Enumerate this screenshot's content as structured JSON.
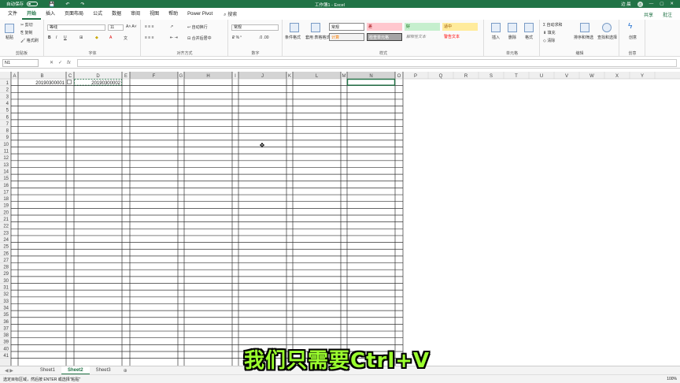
{
  "titlebar": {
    "autosave": "自动保存",
    "autosave_state": "关",
    "title": "工作簿1 - Excel",
    "user": "边 晨",
    "avatar": "边",
    "win_min": "—",
    "win_max": "▢",
    "win_close": "✕"
  },
  "tabs": [
    "文件",
    "开始",
    "插入",
    "页面布局",
    "公式",
    "数据",
    "审阅",
    "视图",
    "帮助",
    "Power Pivot"
  ],
  "search": "搜索",
  "share": "共享",
  "comment": "批注",
  "ribbon": {
    "clipboard": {
      "label": "剪贴板",
      "paste": "粘贴",
      "cut": "剪切",
      "copy": "复制",
      "painter": "格式刷"
    },
    "font": {
      "label": "字体",
      "name": "等线",
      "size": "11"
    },
    "align": {
      "label": "对齐方式",
      "wrap": "自动换行",
      "merge": "合并后居中"
    },
    "number": {
      "label": "数字",
      "format": "常规"
    },
    "styles": {
      "label": "样式",
      "cond": "条件格式",
      "table": "套用\n表格格式",
      "normal": "常规",
      "bad": "差",
      "good": "好",
      "neutral": "适中",
      "calc": "计算",
      "check": "检查单元格",
      "explain": "解释性文本",
      "warn": "警告文本"
    },
    "cells": {
      "label": "单元格",
      "insert": "插入",
      "delete": "删除",
      "format": "格式"
    },
    "edit": {
      "label": "编辑",
      "autosum": "自动求和",
      "fill": "填充",
      "clear": "清除",
      "sort": "排序和筛选",
      "find": "查找和选择"
    },
    "create": {
      "label": "创意",
      "idea": "创意"
    }
  },
  "formula": {
    "namebox": "N1",
    "fx": "fx",
    "value": ""
  },
  "columns": [
    "A",
    "B",
    "C",
    "D",
    "E",
    "F",
    "G",
    "H",
    "I",
    "J",
    "K",
    "L",
    "M",
    "N",
    "O",
    "P",
    "Q",
    "R",
    "S",
    "T",
    "U",
    "V",
    "W",
    "X",
    "Y"
  ],
  "cells": {
    "B1": "20190300001",
    "D1": "20190300002"
  },
  "sheets": [
    "Sheet1",
    "Sheet2",
    "Sheet3"
  ],
  "status": {
    "left": "选定目标区域，然后按 ENTER 或选择\"粘贴\"",
    "zoom": "100%"
  },
  "subtitle": "我们只需要Ctrl+V",
  "colors": {
    "excel_green": "#217346",
    "selected_col": "#d4d4d4",
    "subtitle": "#9bff2e"
  }
}
